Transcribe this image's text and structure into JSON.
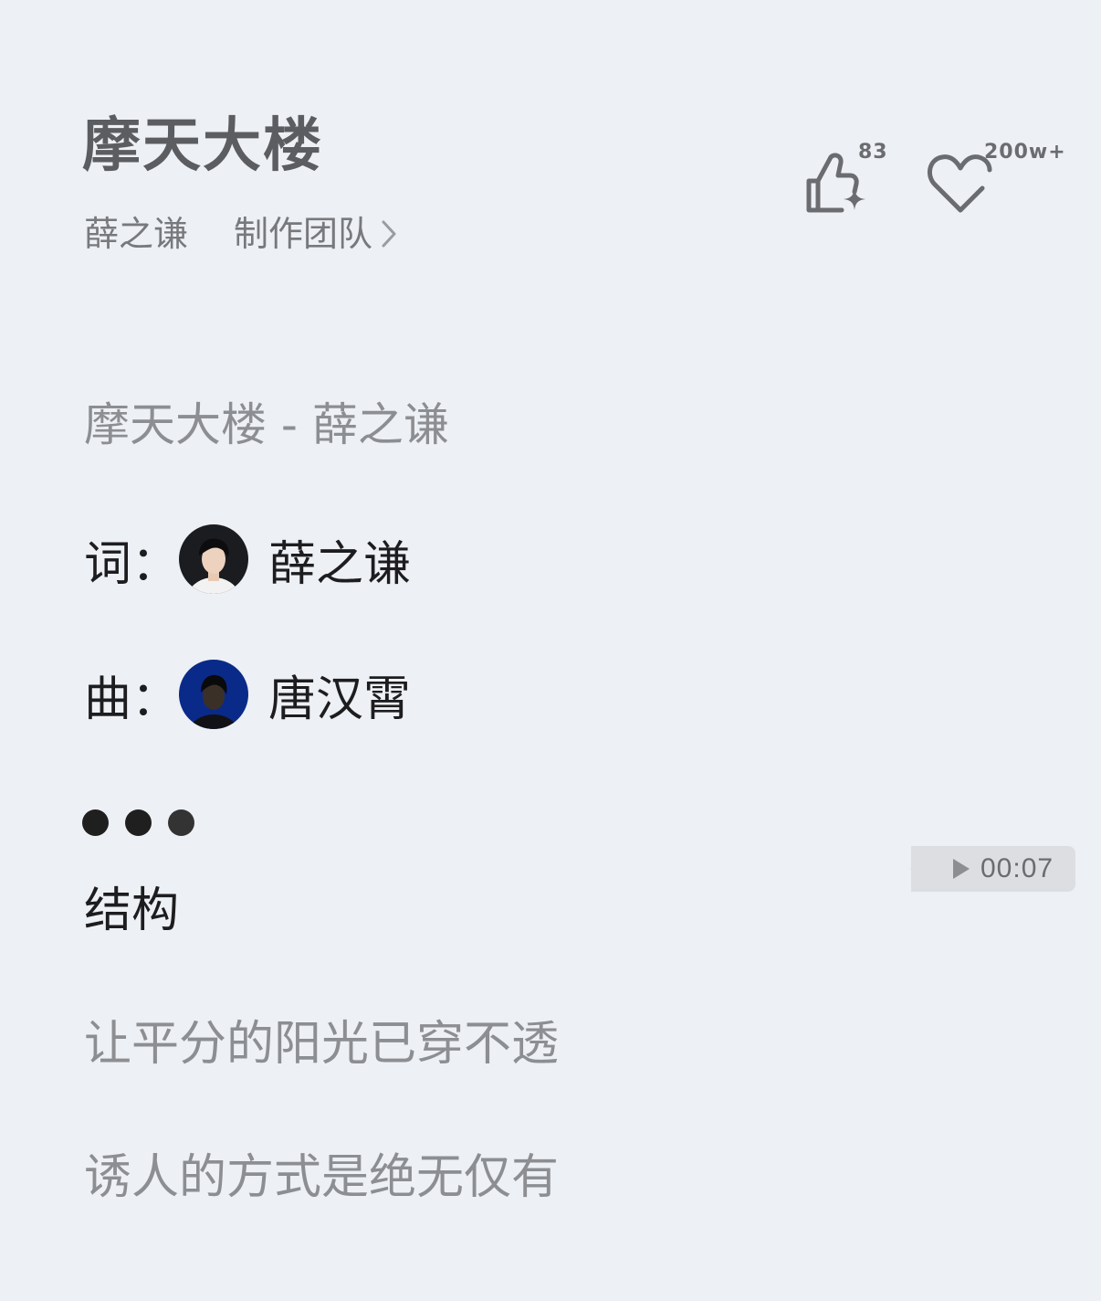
{
  "header": {
    "song_title": "摩天大楼",
    "artist": "薛之谦",
    "team_link": "制作团队",
    "like_count": "83",
    "favorite_count": "200w+"
  },
  "lyrics_header": {
    "heading": "摩天大楼 - 薛之谦",
    "credits": [
      {
        "label": "词：",
        "name": "薛之谦"
      },
      {
        "label": "曲：",
        "name": "唐汉霄"
      }
    ]
  },
  "section": {
    "label": "结构"
  },
  "audio": {
    "duration": "00:07"
  },
  "lyrics": {
    "lines": [
      "让平分的阳光已穿不透",
      "诱人的方式是绝无仅有"
    ]
  },
  "icons": {
    "like": "thumbs-up-sparkle-icon",
    "favorite": "heart-icon",
    "chevron": "chevron-right-icon",
    "play": "play-icon"
  },
  "colors": {
    "background": "#edf0f4",
    "title": "#5b5d61",
    "lyric_muted": "#8c8e92",
    "dark_text": "#1d1d1f",
    "audio_pill": "#dcdee2",
    "composer_avatar_bg": "#0a2a8a"
  }
}
